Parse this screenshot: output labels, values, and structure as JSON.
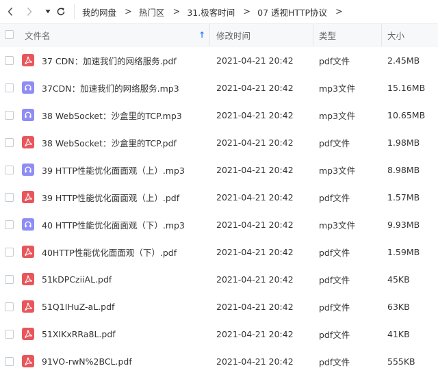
{
  "toolbar": {
    "back_icon": "chevron-left-icon",
    "forward_icon": "chevron-right-icon",
    "dropdown_icon": "caret-down-icon",
    "refresh_icon": "refresh-icon"
  },
  "breadcrumb": [
    {
      "label": "我的网盘"
    },
    {
      "label": "热门区"
    },
    {
      "label": "31.极客时间"
    },
    {
      "label": "07 透视HTTP协议"
    }
  ],
  "breadcrumb_separator": ">",
  "columns": {
    "name": "文件名",
    "modified": "修改时间",
    "type": "类型",
    "size": "大小",
    "sort_indicator": "↑"
  },
  "colors": {
    "pdf": "#e8565b",
    "mp3": "#8f8df5",
    "sort_arrow": "#2f7fff"
  },
  "files": [
    {
      "name": "37 CDN：加速我们的网络服务.pdf",
      "modified": "2021-04-21 20:42",
      "type": "pdf文件",
      "size": "2.45MB",
      "kind": "pdf"
    },
    {
      "name": "37CDN：加速我们的网络服务.mp3",
      "modified": "2021-04-21 20:42",
      "type": "mp3文件",
      "size": "15.16MB",
      "kind": "mp3"
    },
    {
      "name": "38 WebSocket：沙盒里的TCP.mp3",
      "modified": "2021-04-21 20:42",
      "type": "mp3文件",
      "size": "10.65MB",
      "kind": "mp3"
    },
    {
      "name": "38 WebSocket：沙盒里的TCP.pdf",
      "modified": "2021-04-21 20:42",
      "type": "pdf文件",
      "size": "1.98MB",
      "kind": "pdf"
    },
    {
      "name": "39 HTTP性能优化面面观（上）.mp3",
      "modified": "2021-04-21 20:42",
      "type": "mp3文件",
      "size": "8.98MB",
      "kind": "mp3"
    },
    {
      "name": "39 HTTP性能优化面面观（上）.pdf",
      "modified": "2021-04-21 20:42",
      "type": "pdf文件",
      "size": "1.57MB",
      "kind": "pdf"
    },
    {
      "name": "40 HTTP性能优化面面观（下）.mp3",
      "modified": "2021-04-21 20:42",
      "type": "mp3文件",
      "size": "9.93MB",
      "kind": "mp3"
    },
    {
      "name": "40HTTP性能优化面面观（下）.pdf",
      "modified": "2021-04-21 20:42",
      "type": "pdf文件",
      "size": "1.59MB",
      "kind": "pdf"
    },
    {
      "name": "51kDPCziiAL.pdf",
      "modified": "2021-04-21 20:42",
      "type": "pdf文件",
      "size": "45KB",
      "kind": "pdf"
    },
    {
      "name": "51Q1IHuZ-aL.pdf",
      "modified": "2021-04-21 20:42",
      "type": "pdf文件",
      "size": "63KB",
      "kind": "pdf"
    },
    {
      "name": "51XIKxRRa8L.pdf",
      "modified": "2021-04-21 20:42",
      "type": "pdf文件",
      "size": "41KB",
      "kind": "pdf"
    },
    {
      "name": "91VO-rwN%2BCL.pdf",
      "modified": "2021-04-21 20:42",
      "type": "pdf文件",
      "size": "555KB",
      "kind": "pdf"
    }
  ]
}
